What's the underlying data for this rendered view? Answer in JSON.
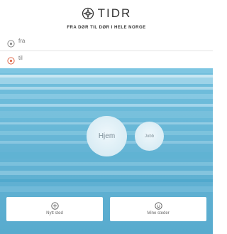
{
  "header": {
    "brand": "TIDR",
    "tagline": "FRA DØR TIL DØR I HELE NORGE",
    "logo_icon": "compass-logo-icon"
  },
  "search": {
    "from": {
      "placeholder": "fra",
      "value": "",
      "icon": "pin-icon",
      "icon_color": "#8a8a8a"
    },
    "to": {
      "placeholder": "til",
      "value": "",
      "icon": "pin-icon",
      "icon_color": "#e06a4c"
    }
  },
  "map": {
    "background": "#6ab9d8",
    "places": [
      {
        "label": "Hjem"
      },
      {
        "label": "Jobb"
      }
    ]
  },
  "actions": {
    "new_place": {
      "label": "Nytt sted",
      "icon": "plus-circle-icon"
    },
    "my_places": {
      "label": "Mine steder",
      "icon": "smile-icon"
    }
  },
  "colors": {
    "accent_to": "#e06a4c",
    "text_dark": "#333333"
  }
}
